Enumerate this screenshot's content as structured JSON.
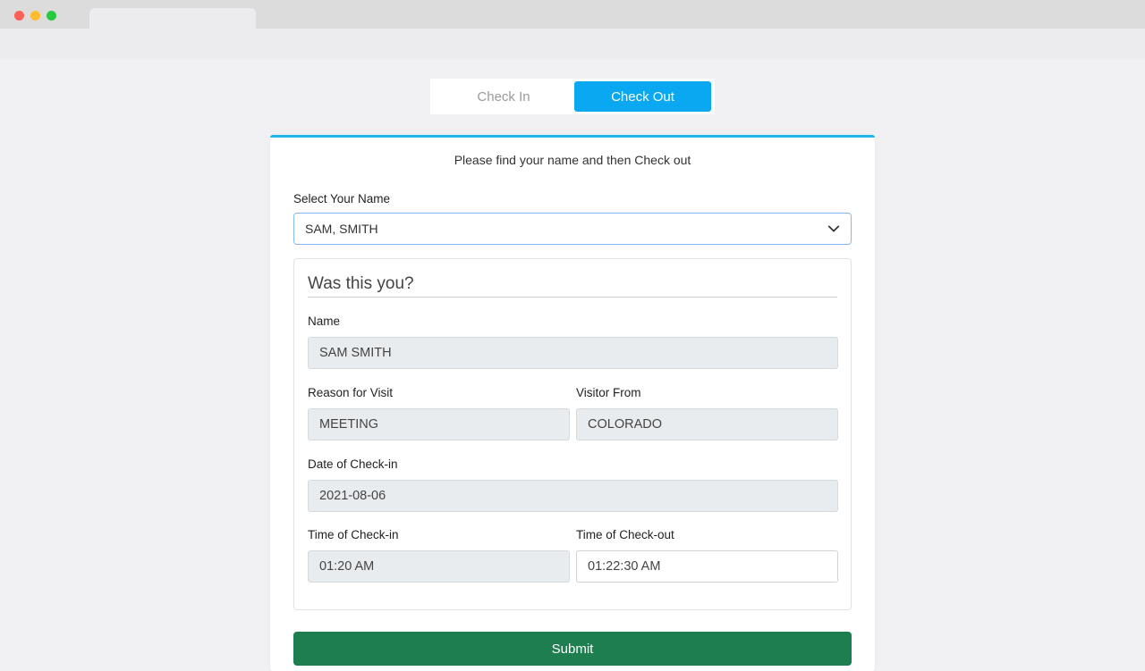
{
  "toggle": {
    "checkin_label": "Check In",
    "checkout_label": "Check Out"
  },
  "card": {
    "instruction": "Please find your name and then Check out",
    "select_label": "Select Your Name",
    "select_value": "SAM, SMITH",
    "inner_title": "Was this you?",
    "fields": {
      "name_label": "Name",
      "name_value": "SAM SMITH",
      "reason_label": "Reason for Visit",
      "reason_value": "MEETING",
      "from_label": "Visitor From",
      "from_value": "COLORADO",
      "date_label": "Date of Check-in",
      "date_value": "2021-08-06",
      "time_in_label": "Time of Check-in",
      "time_in_value": "01:20 AM",
      "time_out_label": "Time of Check-out",
      "time_out_value": "01:22:30 AM"
    },
    "submit_label": "Submit"
  },
  "colors": {
    "accent": "#0aa8f0",
    "card_border": "#1fb6e6",
    "submit_bg": "#1e7e4f"
  },
  "icons": {
    "dropdown": "chevron-down-icon"
  }
}
